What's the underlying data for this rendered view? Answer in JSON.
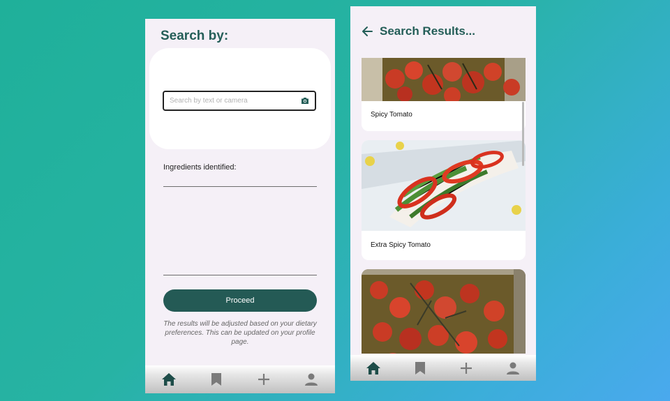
{
  "search_screen": {
    "title": "Search by:",
    "search_placeholder": "Search by text or camera",
    "ingredients_label": "Ingredients identified:",
    "proceed_label": "Proceed",
    "note": "The results will be adjusted based on your dietary preferences. This can be updated on your profile page.",
    "nav": [
      {
        "icon": "home-icon",
        "active": true
      },
      {
        "icon": "bookmark-icon",
        "active": false
      },
      {
        "icon": "plus-icon",
        "active": false
      },
      {
        "icon": "profile-icon",
        "active": false
      }
    ]
  },
  "results_screen": {
    "title": "Search Results...",
    "results": [
      {
        "label": "Spicy Tomato",
        "image": "roasted-tomatoes"
      },
      {
        "label": "Extra Spicy Tomato",
        "image": "pepper-salad"
      },
      {
        "label": "",
        "image": "roasted-tomatoes"
      }
    ],
    "nav": [
      {
        "icon": "home-icon",
        "active": true
      },
      {
        "icon": "bookmark-icon",
        "active": false
      },
      {
        "icon": "plus-icon",
        "active": false
      },
      {
        "icon": "profile-icon",
        "active": false
      }
    ]
  },
  "colors": {
    "accent": "#245e58",
    "phone_bg": "#f5f0f7",
    "button_bg": "#245a55"
  }
}
